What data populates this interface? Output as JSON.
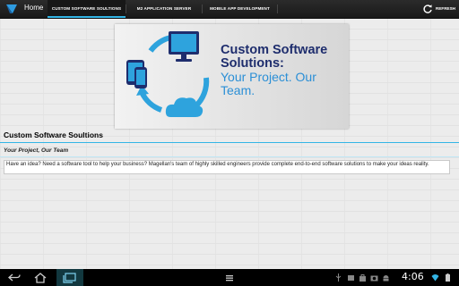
{
  "actionbar": {
    "home_label": "Home",
    "tabs": [
      {
        "label": "CUSTOM SOFTWARE SOULTIONS",
        "active": true
      },
      {
        "label": "M2 APPLICATION SERVER",
        "active": false
      },
      {
        "label": "MOBILE APP DEVELOPMENT",
        "active": false
      }
    ],
    "refresh_label": "REFRESH"
  },
  "banner": {
    "title": "Custom Software Solutions:",
    "tagline": "Your Project. Our Team."
  },
  "content": {
    "section_title": "Custom Software Soultions",
    "subtitle": "Your Project, Our Team",
    "description": "Have an idea?  Need a software tool to help your business?  Magellan's team of highly skilled engineers provide complete end-to-end software solutions to make your ideas reality."
  },
  "systembar": {
    "clock": "4:06"
  },
  "colors": {
    "accent": "#33b5e5",
    "banner_title": "#1e2d6d",
    "banner_tag": "#2b8fd6"
  }
}
